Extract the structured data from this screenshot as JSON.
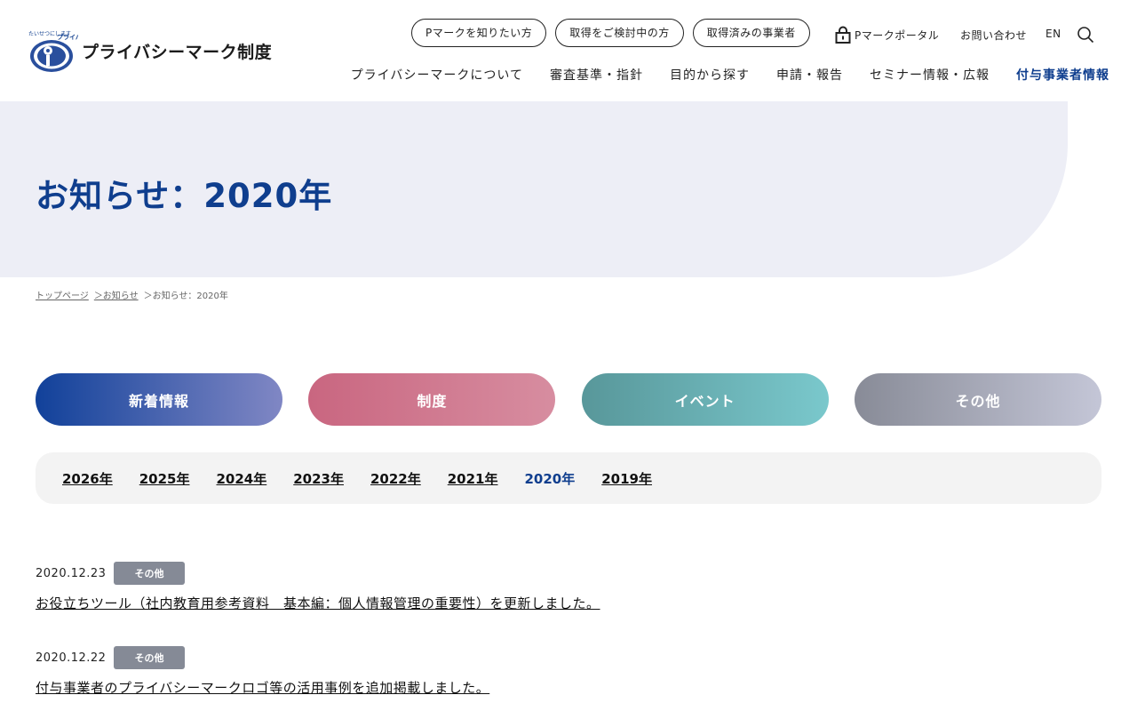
{
  "header": {
    "logo_text": "プライバシーマーク制度",
    "logo_tagline": "たいせつにしますプライバシー",
    "pills": [
      "Pマークを知りたい方",
      "取得をご検討中の方",
      "取得済みの事業者"
    ],
    "portal_label": "Pマークポータル",
    "contact_label": "お問い合わせ",
    "lang_label": "EN",
    "nav": [
      {
        "label": "プライバシーマークについて"
      },
      {
        "label": "審査基準・指針"
      },
      {
        "label": "目的から探す"
      },
      {
        "label": "申請・報告"
      },
      {
        "label": "セミナー情報・広報"
      },
      {
        "label": "付与事業者情報"
      }
    ]
  },
  "hero": {
    "title": "お知らせ：2020年"
  },
  "breadcrumb": [
    {
      "label": "トップページ"
    },
    {
      "label": "＞お知らせ"
    },
    {
      "label": "＞お知らせ：2020年"
    }
  ],
  "categories": [
    {
      "label": "新着情報"
    },
    {
      "label": "制度"
    },
    {
      "label": "イベント"
    },
    {
      "label": "その他"
    }
  ],
  "years": [
    "2026年",
    "2025年",
    "2024年",
    "2023年",
    "2022年",
    "2021年",
    "2020年",
    "2019年"
  ],
  "news": [
    {
      "date": "2020.12.23",
      "tag": "その他",
      "title": "お役立ちツール（社内教育用参考資料　基本編：個人情報管理の重要性）を更新しました。"
    },
    {
      "date": "2020.12.22",
      "tag": "その他",
      "title": "付与事業者のプライバシーマークロゴ等の活用事例を追加掲載しました。"
    }
  ],
  "colors": {
    "brand_blue": "#0f3e8e",
    "hero_bg": "#edeef6",
    "tag_gray": "#858a96"
  }
}
